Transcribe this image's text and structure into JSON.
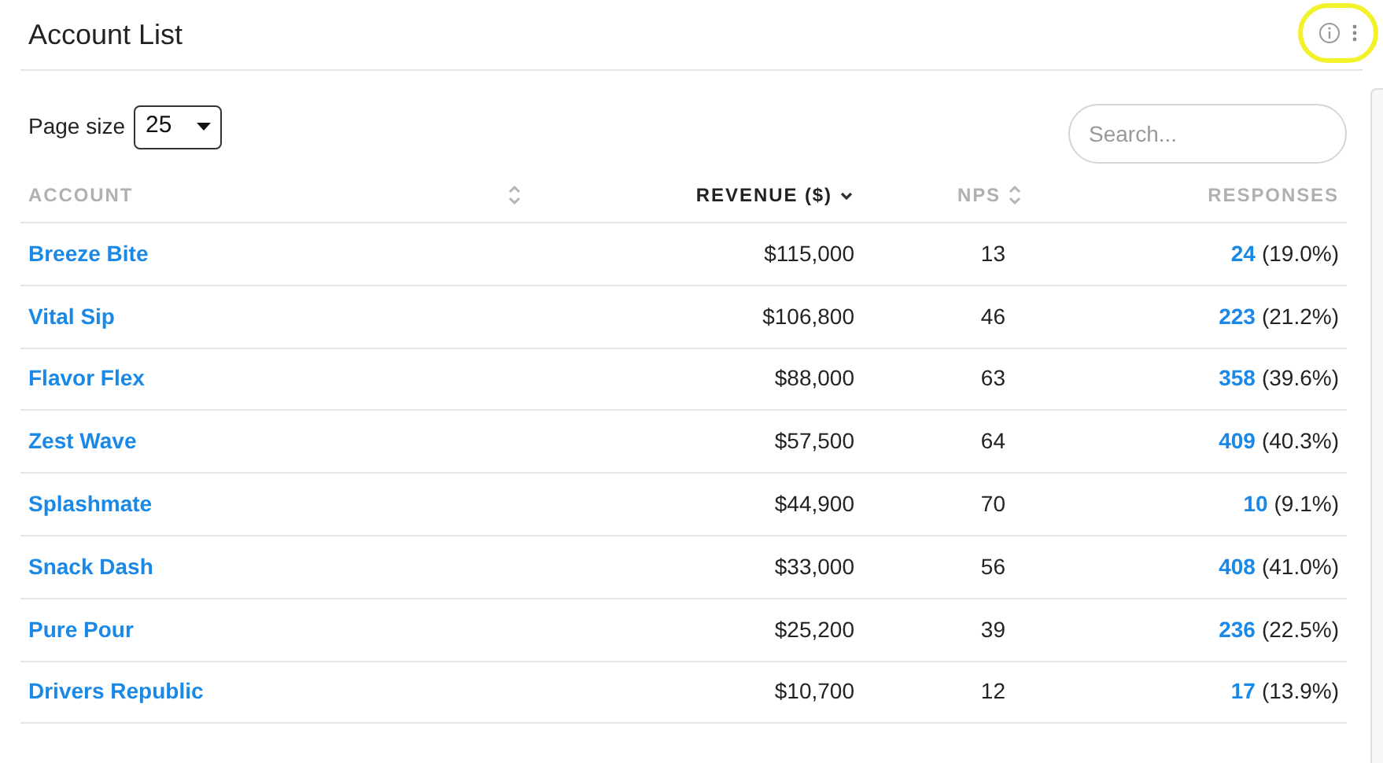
{
  "header": {
    "title": "Account List"
  },
  "controls": {
    "page_size_label": "Page size",
    "page_size": "25",
    "search": {
      "placeholder": "Search..."
    }
  },
  "table": {
    "columns": [
      {
        "label": "ACCOUNT",
        "sortable": true,
        "sorted": false
      },
      {
        "label": "REVENUE ($)",
        "sortable": true,
        "sorted": true
      },
      {
        "label": "NPS",
        "sortable": true,
        "sorted": false
      },
      {
        "label": "RESPONSES",
        "sortable": false,
        "sorted": false
      }
    ],
    "rows": [
      {
        "account": "Breeze Bite",
        "revenue": "$115,000",
        "nps": "13",
        "responses": "24",
        "share": "(19.0%)"
      },
      {
        "account": "Vital Sip",
        "revenue": "$106,800",
        "nps": "46",
        "responses": "223",
        "share": "(21.2%)"
      },
      {
        "account": "Flavor Flex",
        "revenue": "$88,000",
        "nps": "63",
        "responses": "358",
        "share": "(39.6%)"
      },
      {
        "account": "Zest Wave",
        "revenue": "$57,500",
        "nps": "64",
        "responses": "409",
        "share": "(40.3%)"
      },
      {
        "account": "Splashmate",
        "revenue": "$44,900",
        "nps": "70",
        "responses": "10",
        "share": "(9.1%)"
      },
      {
        "account": "Snack Dash",
        "revenue": "$33,000",
        "nps": "56",
        "responses": "408",
        "share": "(41.0%)"
      },
      {
        "account": "Pure Pour",
        "revenue": "$25,200",
        "nps": "39",
        "responses": "236",
        "share": "(22.5%)"
      },
      {
        "account": "Drivers Republic",
        "revenue": "$10,700",
        "nps": "12",
        "responses": "17",
        "share": "(13.9%)"
      }
    ]
  }
}
